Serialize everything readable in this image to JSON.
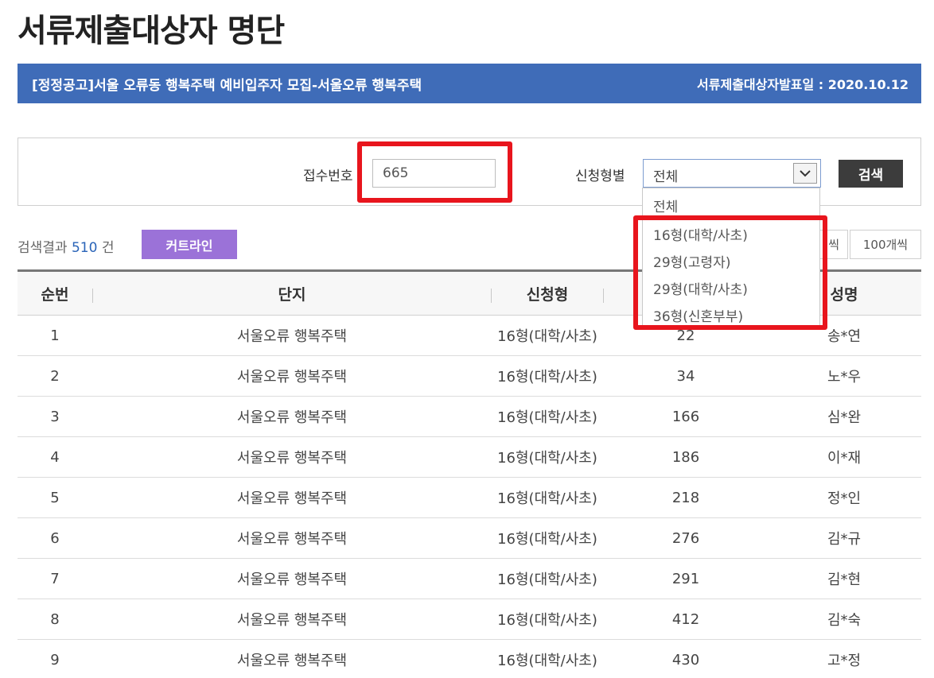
{
  "page": {
    "title": "서류제출대상자 명단"
  },
  "banner": {
    "notice": "[정정공고]서울 오류동 행복주택 예비입주자 모집-서울오류 행복주택",
    "date_label": "서류제출대상자발표일 : 2020.10.12"
  },
  "search": {
    "receipt_label": "접수번호",
    "receipt_value": "665",
    "type_label": "신청형별",
    "type_selected": "전체",
    "search_button": "검색",
    "type_options": [
      "전체",
      "16형(대학/사초)",
      "29형(고령자)",
      "29형(대학/사초)",
      "36형(신혼부부)"
    ]
  },
  "results": {
    "prefix": "검색결과",
    "count": "510",
    "suffix": "건",
    "curtain_button": "커트라인",
    "per_page_50": "씩",
    "per_page_100": "100개씩"
  },
  "table": {
    "headers": {
      "no": "순번",
      "complex": "단지",
      "type": "신청형",
      "name": "성명"
    },
    "rows": [
      {
        "no": "1",
        "complex": "서울오류 행복주택",
        "type": "16형(대학/사초)",
        "receipt": "22",
        "name": "송*연"
      },
      {
        "no": "2",
        "complex": "서울오류 행복주택",
        "type": "16형(대학/사초)",
        "receipt": "34",
        "name": "노*우"
      },
      {
        "no": "3",
        "complex": "서울오류 행복주택",
        "type": "16형(대학/사초)",
        "receipt": "166",
        "name": "심*완"
      },
      {
        "no": "4",
        "complex": "서울오류 행복주택",
        "type": "16형(대학/사초)",
        "receipt": "186",
        "name": "이*재"
      },
      {
        "no": "5",
        "complex": "서울오류 행복주택",
        "type": "16형(대학/사초)",
        "receipt": "218",
        "name": "정*인"
      },
      {
        "no": "6",
        "complex": "서울오류 행복주택",
        "type": "16형(대학/사초)",
        "receipt": "276",
        "name": "김*규"
      },
      {
        "no": "7",
        "complex": "서울오류 행복주택",
        "type": "16형(대학/사초)",
        "receipt": "291",
        "name": "김*현"
      },
      {
        "no": "8",
        "complex": "서울오류 행복주택",
        "type": "16형(대학/사초)",
        "receipt": "412",
        "name": "김*숙"
      },
      {
        "no": "9",
        "complex": "서울오류 행복주택",
        "type": "16형(대학/사초)",
        "receipt": "430",
        "name": "고*정"
      }
    ]
  },
  "colors": {
    "banner": "#3f6cb8",
    "curtain": "#9b72d8",
    "highlight": "#e8151d",
    "count": "#2a64b8"
  }
}
